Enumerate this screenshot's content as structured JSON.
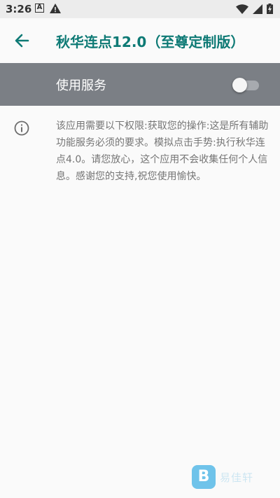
{
  "status_bar": {
    "time": "3:26",
    "notification_icons": [
      "a-icon",
      "warning-icon"
    ],
    "system_icons": [
      "wifi-icon",
      "signal-icon",
      "battery-icon"
    ]
  },
  "app_bar": {
    "title": "秋华连点12.0（至尊定制版）",
    "back_icon": "arrow-left-icon",
    "accent": "#0e7a75"
  },
  "service": {
    "label": "使用服务",
    "enabled": false,
    "bar_color": "#7b7f85"
  },
  "info": {
    "icon": "info-icon",
    "description": "该应用需要以下权限:获取您的操作:这是所有辅助功能服务必须的要求。模拟点击手势:执行秋华连点4.0。请您放心，这个应用不会收集任何个人信息。感谢您的支持,祝您使用愉快。"
  },
  "watermark": {
    "logo_letter": "B",
    "text": "易佳轩"
  }
}
